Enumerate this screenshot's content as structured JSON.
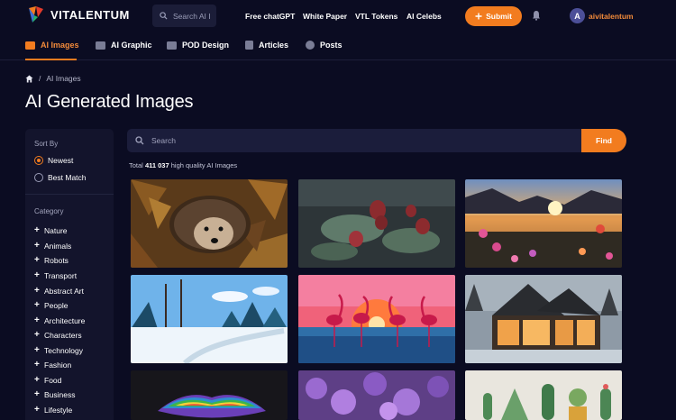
{
  "brand": {
    "name": "VITALENTUM"
  },
  "topbar": {
    "search_placeholder": "Search AI I",
    "links": [
      "Free chatGPT",
      "White Paper",
      "VTL Tokens",
      "AI Celebs"
    ],
    "submit_label": "Submit",
    "avatar_initial": "A",
    "username": "aivitalentum"
  },
  "tabs": [
    {
      "label": "AI Images",
      "active": true
    },
    {
      "label": "AI Graphic",
      "active": false
    },
    {
      "label": "POD Design",
      "active": false
    },
    {
      "label": "Articles",
      "active": false
    },
    {
      "label": "Posts",
      "active": false
    }
  ],
  "breadcrumb": {
    "separator": "/",
    "current": "AI Images"
  },
  "page_title": "AI Generated Images",
  "sidebar": {
    "sort_heading": "Sort By",
    "sort_options": [
      {
        "label": "Newest",
        "selected": true
      },
      {
        "label": "Best Match",
        "selected": false
      }
    ],
    "category_heading": "Category",
    "categories": [
      "Nature",
      "Animals",
      "Robots",
      "Transport",
      "Abstract Art",
      "People",
      "Architecture",
      "Characters",
      "Technology",
      "Fashion",
      "Food",
      "Business",
      "Lifestyle"
    ]
  },
  "main": {
    "search_placeholder": "Search",
    "find_label": "Find",
    "total_prefix": "Total",
    "total_count": "411 037",
    "total_suffix": "high quality AI Images"
  },
  "images": [
    {
      "subject": "hedgehog in autumn leaves"
    },
    {
      "subject": "red lotus buds on dark pond"
    },
    {
      "subject": "flowers by lake at sunset"
    },
    {
      "subject": "snowy winter forest path"
    },
    {
      "subject": "flamingos at pink sunset"
    },
    {
      "subject": "modern glass house in evening"
    },
    {
      "subject": "rainbow lips on dark background"
    },
    {
      "subject": "purple lavender flowers"
    },
    {
      "subject": "potted cactus plants"
    }
  ],
  "colors": {
    "background": "#0b0c22",
    "accent": "#f27c1f",
    "panel": "#13142c"
  }
}
